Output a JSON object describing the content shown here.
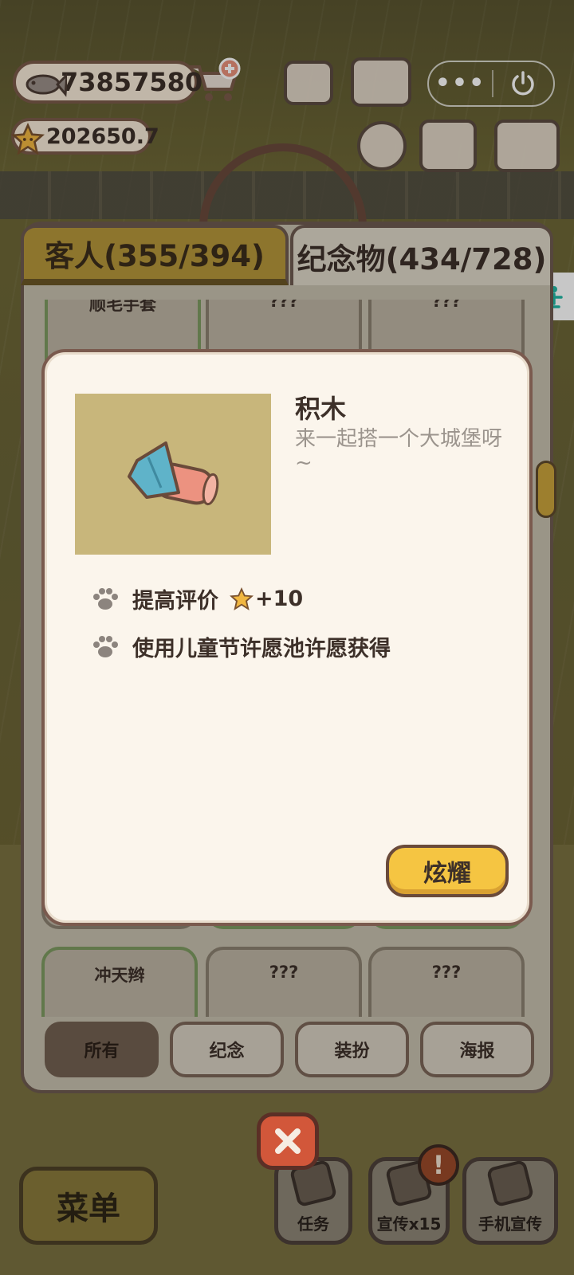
{
  "hud": {
    "fish_count": "73857580",
    "star_rating": "202650.7"
  },
  "miniprogram": {
    "more_icon": "more-dots-icon",
    "power_icon": "power-icon"
  },
  "tabs": [
    {
      "label": "客人(355/394)",
      "active": false
    },
    {
      "label": "纪念物(434/728)",
      "active": true
    }
  ],
  "grid": {
    "top_row": [
      "顺毛手套",
      "???",
      "???"
    ],
    "bottom_row": [
      "冲天辫",
      "???",
      "???"
    ]
  },
  "filters": [
    {
      "label": "所有",
      "active": true
    },
    {
      "label": "纪念",
      "active": false
    },
    {
      "label": "装扮",
      "active": false
    },
    {
      "label": "海报",
      "active": false
    }
  ],
  "modal": {
    "name": "积木",
    "description": "来一起搭一个大城堡呀~",
    "effect_label": "提高评价",
    "effect_value": "+10",
    "source": "使用儿童节许愿池许愿获得",
    "show_button": "炫耀"
  },
  "bottom_bar": {
    "menu": "菜单",
    "task": "任务",
    "promo": "宣传x15",
    "phone_promo": "手机宣传",
    "alert_badge": "!"
  },
  "colors": {
    "accent_yellow": "#f5c542",
    "tab_active_gold": "#b5963a",
    "modal_bg": "#fbf5ec",
    "close_red": "#d2573a"
  }
}
